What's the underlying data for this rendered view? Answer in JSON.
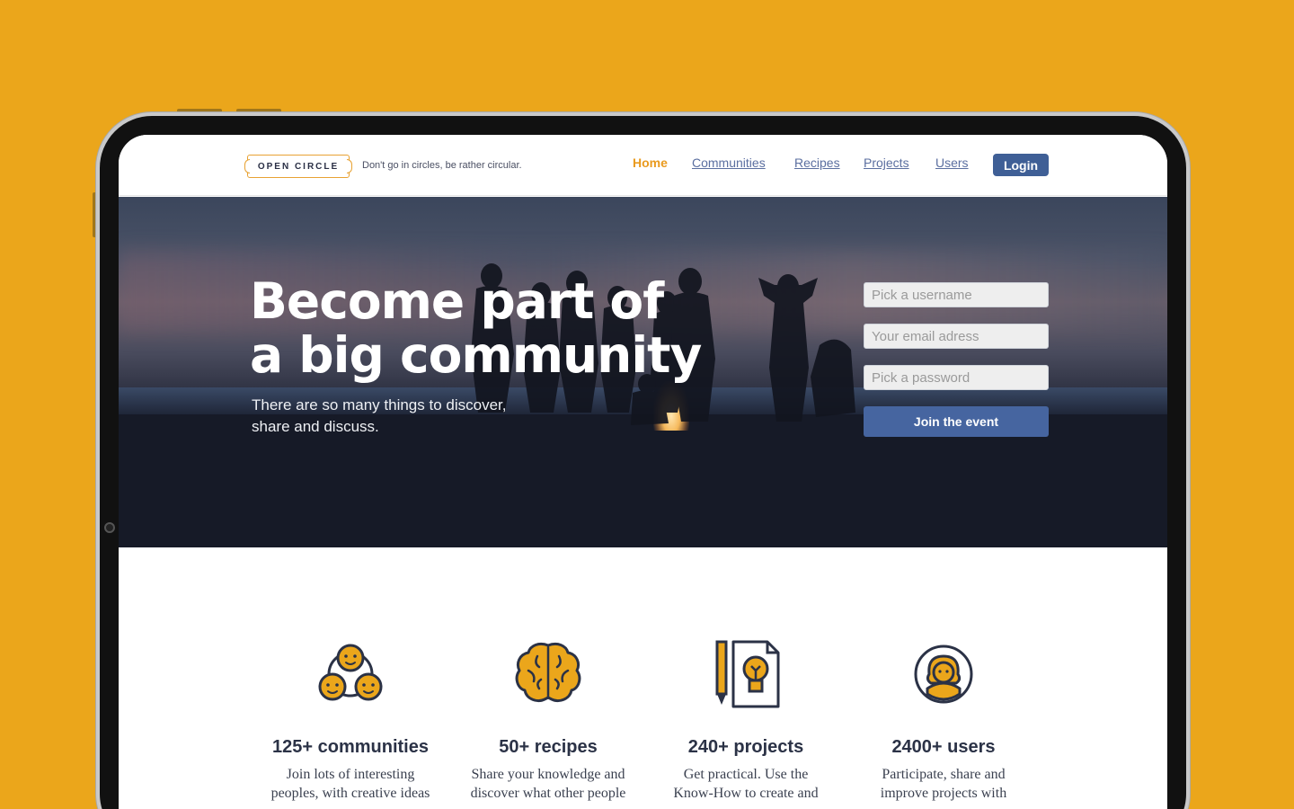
{
  "brand": {
    "logo_text": "OPEN CIRCLE",
    "tagline": "Don't go in circles, be rather circular."
  },
  "nav": {
    "items": [
      {
        "label": "Home",
        "active": true
      },
      {
        "label": "Communities",
        "active": false
      },
      {
        "label": "Recipes",
        "active": false
      },
      {
        "label": "Projects",
        "active": false
      },
      {
        "label": "Users",
        "active": false
      }
    ],
    "login_label": "Login"
  },
  "hero": {
    "title_line1": "Become part of",
    "title_line2": "a big community",
    "subtitle_line1": "There are so many things to discover,",
    "subtitle_line2": "share and discuss.",
    "form": {
      "username_placeholder": "Pick a username",
      "email_placeholder": "Your email adress",
      "password_placeholder": "Pick a password",
      "submit_label": "Join the event"
    }
  },
  "stats": [
    {
      "icon": "people-icon",
      "title": "125+ communities",
      "desc_line1": "Join lots of interesting",
      "desc_line2": "peoples, with creative ideas"
    },
    {
      "icon": "brain-icon",
      "title": "50+ recipes",
      "desc_line1": "Share your knowledge and",
      "desc_line2": "discover what other people"
    },
    {
      "icon": "idea-document-icon",
      "title": "240+ projects",
      "desc_line1": "Get practical. Use the",
      "desc_line2": "Know-How to create and"
    },
    {
      "icon": "user-avatar-icon",
      "title": "2400+ users",
      "desc_line1": "Participate, share and",
      "desc_line2": "improve projects with"
    }
  ],
  "colors": {
    "background": "#EBA61B",
    "accent_orange": "#E99A1E",
    "primary_blue": "#3F5F96",
    "link_blue": "#5B6FA0",
    "text_dark": "#2b3246"
  }
}
